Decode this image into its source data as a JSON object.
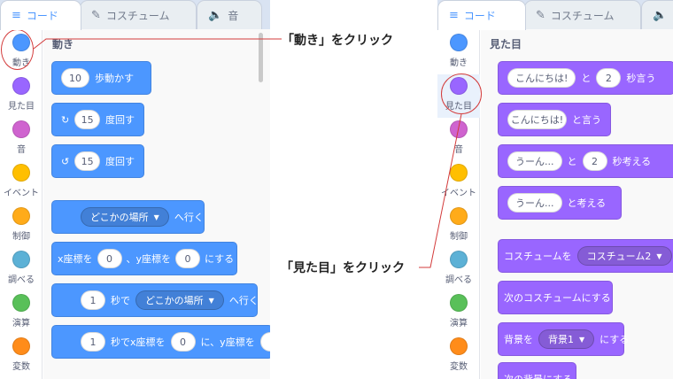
{
  "left": {
    "tabs": [
      {
        "label": "コード",
        "icon": "code-icon",
        "active": true
      },
      {
        "label": "コスチューム",
        "icon": "brush-icon",
        "active": false
      },
      {
        "label": "音",
        "icon": "speaker-icon",
        "active": false
      }
    ],
    "categories": [
      {
        "label": "動き",
        "color": "#4c97ff"
      },
      {
        "label": "見た目",
        "color": "#9966ff"
      },
      {
        "label": "音",
        "color": "#cf63cf"
      },
      {
        "label": "イベント",
        "color": "#ffbf00"
      },
      {
        "label": "制御",
        "color": "#ffab19"
      },
      {
        "label": "調べる",
        "color": "#5cb1d6"
      },
      {
        "label": "演算",
        "color": "#59c059"
      },
      {
        "label": "変数",
        "color": "#ff8c1a"
      }
    ],
    "section_title": "動き",
    "blocks": {
      "move": {
        "value": "10",
        "text": "歩動かす"
      },
      "turn_right": {
        "value": "15",
        "text": "度回す"
      },
      "turn_left": {
        "value": "15",
        "text": "度回す"
      },
      "goto": {
        "dropdown": "どこかの場所",
        "text": "へ行く"
      },
      "goto_xy": {
        "x_label": "x座標を",
        "x_value": "0",
        "y_label": "、y座標を",
        "y_value": "0",
        "suffix": "にする"
      },
      "glide": {
        "value": "1",
        "text1": "秒で",
        "dropdown": "どこかの場所",
        "text2": "へ行く"
      },
      "glide_xy": {
        "value": "1",
        "text1": "秒でx座標を",
        "x_value": "0",
        "text2": "に、y座標を"
      }
    }
  },
  "right": {
    "tabs": [
      {
        "label": "コード",
        "icon": "code-icon",
        "active": true
      },
      {
        "label": "コスチューム",
        "icon": "brush-icon",
        "active": false
      },
      {
        "label": "",
        "icon": "speaker-icon",
        "active": false
      }
    ],
    "categories": [
      {
        "label": "動き",
        "color": "#4c97ff"
      },
      {
        "label": "見た目",
        "color": "#9966ff"
      },
      {
        "label": "音",
        "color": "#cf63cf"
      },
      {
        "label": "イベント",
        "color": "#ffbf00"
      },
      {
        "label": "制御",
        "color": "#ffab19"
      },
      {
        "label": "調べる",
        "color": "#5cb1d6"
      },
      {
        "label": "演算",
        "color": "#59c059"
      },
      {
        "label": "変数",
        "color": "#ff8c1a"
      }
    ],
    "section_title": "見た目",
    "blocks": {
      "say_secs": {
        "message": "こんにちは!",
        "text1": "と",
        "secs": "2",
        "text2": "秒言う"
      },
      "say": {
        "message": "こんにちは!",
        "text": "と言う"
      },
      "think_secs": {
        "message": "うーん...",
        "text1": "と",
        "secs": "2",
        "text2": "秒考える"
      },
      "think": {
        "message": "うーん...",
        "text": "と考える"
      },
      "switch_costume": {
        "text": "コスチュームを",
        "dropdown": "コスチューム2"
      },
      "next_costume": {
        "text": "次のコスチュームにする"
      },
      "switch_backdrop": {
        "text": "背景を",
        "dropdown": "背景1",
        "suffix": "にする"
      },
      "next_backdrop": {
        "text": "次の背景にする"
      }
    }
  },
  "annotations": {
    "motion": "「動き」をクリック",
    "looks": "「見た目」をクリック"
  },
  "colors": {
    "highlight": "#d33b3b",
    "motion": "#4c97ff",
    "looks": "#9966ff"
  }
}
